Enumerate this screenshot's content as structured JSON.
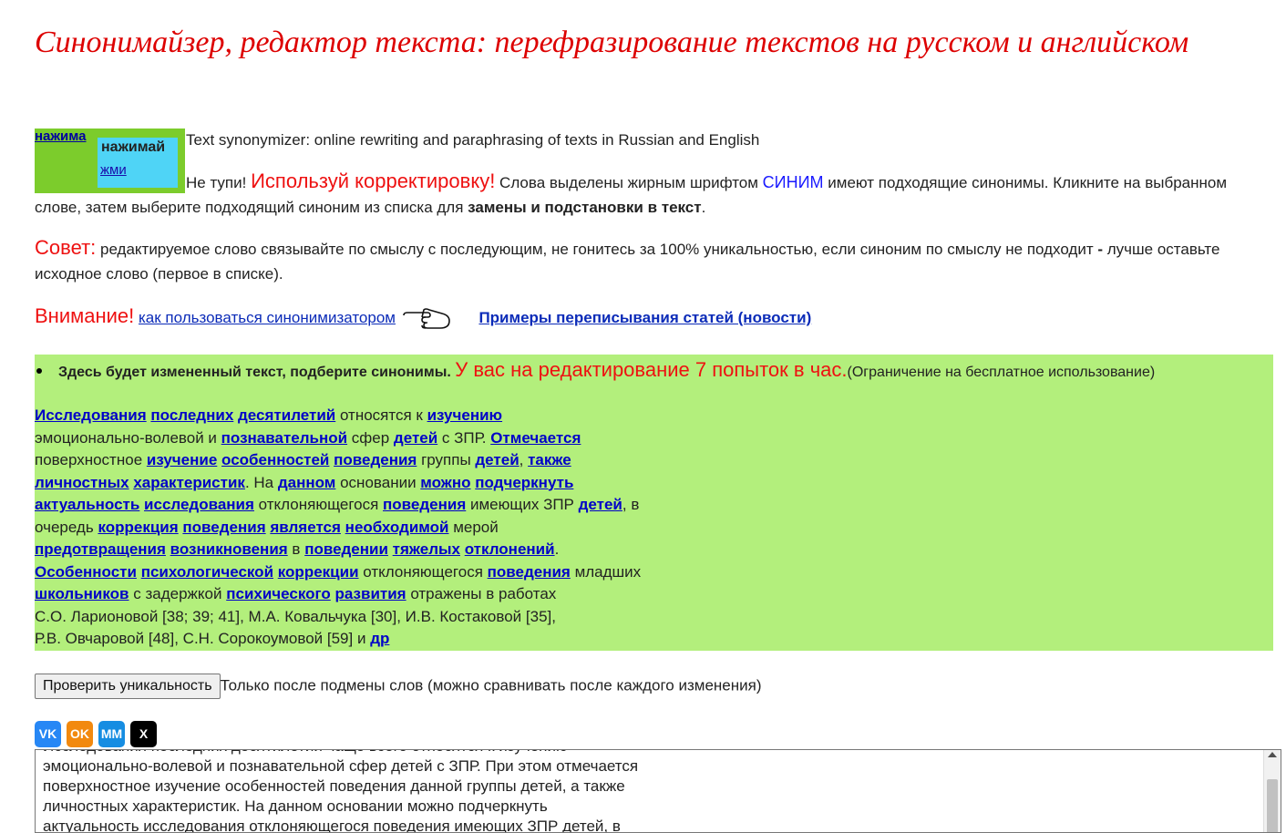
{
  "page": {
    "title": "Синонимайзер, редактор текста: перефразирование текстов на русском и английском",
    "subtitle": "Text synonymizer: online rewriting and paraphrasing of texts in Russian and English"
  },
  "promo": {
    "top_link": "нажима",
    "box_label": "нажимай",
    "box_link": "жми"
  },
  "intro": {
    "lead": "Не тупи! ",
    "highlight": "Используй корректировку!",
    "t1": " Слова выделены жирным шрифтом ",
    "blue_word": "СИНИМ",
    "t2": " имеют подходящие синонимы. Кликните на выбранном слове, затем выберите подходящий синоним из списка для ",
    "bold": "замены и подстановки в текст",
    "end": "."
  },
  "tip": {
    "label": "Совет:",
    "t1": " редактируемое слово связывайте по смыслу с последующим, не гонитесь за 100% уникальностью, если синоним по смыслу не подходит ",
    "dash": "-",
    "t2": " лучше оставьте исходное слово (первое в списке)."
  },
  "attention": {
    "label": "Внимание!",
    "how_to_link": "как пользоваться синонимизатором",
    "examples_link": "Примеры переписывания статей (новости)"
  },
  "result": {
    "notice_bold": "Здесь будет измененный текст, подберите синонимы.",
    "notice_red": "У вас на редактирование 7 попыток в час.",
    "notice_limit": "(Ограничение на бесплатное использование)",
    "tokens": [
      {
        "t": "Исследования",
        "l": true
      },
      {
        "t": " "
      },
      {
        "t": "последних",
        "l": true
      },
      {
        "t": " "
      },
      {
        "t": "десятилетий",
        "l": true
      },
      {
        "t": " относятся к "
      },
      {
        "t": "изучению",
        "l": true
      },
      {
        "br": true
      },
      {
        "t": "эмоционально-волевой и "
      },
      {
        "t": "познавательной",
        "l": true
      },
      {
        "t": " сфер "
      },
      {
        "t": "детей",
        "l": true
      },
      {
        "t": " с ЗПР. "
      },
      {
        "t": "Отмечается",
        "l": true
      },
      {
        "br": true
      },
      {
        "t": "поверхностное "
      },
      {
        "t": "изучение",
        "l": true
      },
      {
        "t": " "
      },
      {
        "t": "особенностей",
        "l": true
      },
      {
        "t": " "
      },
      {
        "t": "поведения",
        "l": true
      },
      {
        "t": " группы "
      },
      {
        "t": "детей",
        "l": true
      },
      {
        "t": ", "
      },
      {
        "t": "также",
        "l": true
      },
      {
        "br": true
      },
      {
        "t": "личностных",
        "l": true
      },
      {
        "t": " "
      },
      {
        "t": "характеристик",
        "l": true
      },
      {
        "t": ". На "
      },
      {
        "t": "данном",
        "l": true
      },
      {
        "t": " основании "
      },
      {
        "t": "можно",
        "l": true
      },
      {
        "t": " "
      },
      {
        "t": "подчеркнуть",
        "l": true
      },
      {
        "br": true
      },
      {
        "t": "актуальность",
        "l": true
      },
      {
        "t": " "
      },
      {
        "t": "исследования",
        "l": true
      },
      {
        "t": " отклоняющегося "
      },
      {
        "t": "поведения",
        "l": true
      },
      {
        "t": " имеющих ЗПР "
      },
      {
        "t": "детей",
        "l": true
      },
      {
        "t": ", в"
      },
      {
        "br": true
      },
      {
        "t": "очередь "
      },
      {
        "t": "коррекция",
        "l": true
      },
      {
        "t": " "
      },
      {
        "t": "поведения",
        "l": true
      },
      {
        "t": " "
      },
      {
        "t": "является",
        "l": true
      },
      {
        "t": " "
      },
      {
        "t": "необходимой",
        "l": true
      },
      {
        "t": " мерой"
      },
      {
        "br": true
      },
      {
        "t": "предотвращения",
        "l": true
      },
      {
        "t": " "
      },
      {
        "t": "возникновения",
        "l": true
      },
      {
        "t": " в "
      },
      {
        "t": "поведении",
        "l": true
      },
      {
        "t": " "
      },
      {
        "t": "тяжелых",
        "l": true
      },
      {
        "t": " "
      },
      {
        "t": "отклонений",
        "l": true
      },
      {
        "t": "."
      },
      {
        "br": true
      },
      {
        "t": "Особенности",
        "l": true
      },
      {
        "t": " "
      },
      {
        "t": "психологической",
        "l": true
      },
      {
        "t": " "
      },
      {
        "t": "коррекции",
        "l": true
      },
      {
        "t": " отклоняющегося "
      },
      {
        "t": "поведения",
        "l": true
      },
      {
        "t": " младших"
      },
      {
        "br": true
      },
      {
        "t": "школьников",
        "l": true
      },
      {
        "t": " с задержкой "
      },
      {
        "t": "психического",
        "l": true
      },
      {
        "t": " "
      },
      {
        "t": "развития",
        "l": true
      },
      {
        "t": " отражены в работах"
      },
      {
        "br": true
      },
      {
        "t": "С.О. Ларионовой [38; 39; 41], М.А. Ковальчука [30], И.В. Костаковой [35],"
      },
      {
        "br": true
      },
      {
        "t": "Р.В. Овчаровой [48], С.Н. Сорокоумовой [59] и "
      },
      {
        "t": "др",
        "l": true
      }
    ]
  },
  "check": {
    "button": "Проверить уникальность",
    "note": "Только после подмены слов (можно сравнивать после каждого изменения)"
  },
  "share": {
    "vk": "VK",
    "ok": "OK",
    "mm": "MM",
    "x": "X"
  },
  "textarea": {
    "lines": [
      "Исследования последних десятилетий чаще всего относятся к изучению",
      "эмоционально-волевой и познавательной сфер детей с ЗПР. При этом отмечается",
      "поверхностное изучение особенностей поведения данной группы детей, а также",
      "личностных характеристик. На данном основании можно подчеркнуть",
      "актуальность исследования отклоняющегося поведения имеющих ЗПР детей, в"
    ]
  }
}
